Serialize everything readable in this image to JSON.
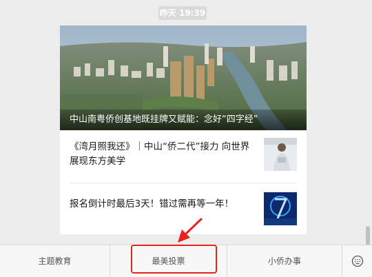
{
  "timestamp": "昨天 19:39",
  "article": {
    "hero_caption": "中山南粤侨创基地既挂牌又赋能：念好“四字经”",
    "items": [
      {
        "title": "《湾月照我还》｜中山“侨二代”接力 向世界展现东方美学"
      },
      {
        "title": "报名倒计时最后3天！错过需再等一年！"
      }
    ]
  },
  "bottom_menu": {
    "items": [
      {
        "label": "主题教育"
      },
      {
        "label": "最美投票"
      },
      {
        "label": "小侨办事"
      }
    ],
    "keyboard_icon": "keyboard-icon"
  },
  "colors": {
    "highlight": "#e8211c"
  }
}
